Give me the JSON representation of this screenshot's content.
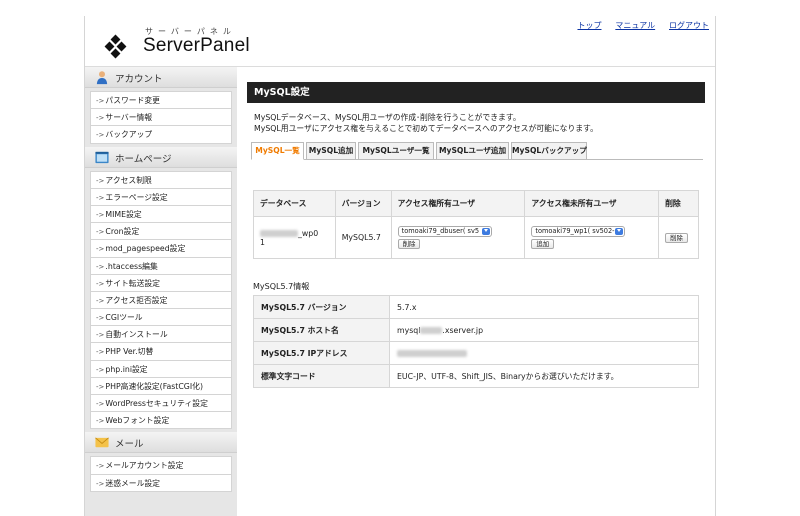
{
  "header": {
    "logo_kana": "サーバーパネル",
    "logo_text": "ServerPanel",
    "links": [
      "トップ",
      "マニュアル",
      "ログアウト"
    ]
  },
  "sidebar": {
    "sections": [
      {
        "title": "アカウント",
        "icon": "user-icon",
        "items": [
          "パスワード変更",
          "サーバー情報",
          "バックアップ"
        ]
      },
      {
        "title": "ホームページ",
        "icon": "homepage-icon",
        "items": [
          "アクセス制限",
          "エラーページ設定",
          "MIME設定",
          "Cron設定",
          "mod_pagespeed設定",
          ".htaccess編集",
          "サイト転送設定",
          "アクセス拒否設定",
          "CGIツール",
          "自動インストール",
          "PHP Ver.切替",
          "php.ini設定",
          "PHP高速化設定(FastCGI化)",
          "WordPressセキュリティ設定",
          "Webフォント設定"
        ]
      },
      {
        "title": "メール",
        "icon": "mail-icon",
        "items": [
          "メールアカウント設定",
          "迷惑メール設定"
        ]
      }
    ]
  },
  "main": {
    "title": "MySQL設定",
    "desc1": "MySQLデータベース、MySQL用ユーザの作成･削除を行うことができます。",
    "desc2": "MySQL用ユーザにアクセス権を与えることで初めてデータベースへのアクセスが可能になります。",
    "tabs": [
      "MySQL一覧",
      "MySQL追加",
      "MySQLユーザ一覧",
      "MySQLユーザ追加",
      "MySQLバックアップ"
    ],
    "active_tab": 0,
    "db_table": {
      "headers": [
        "データベース",
        "バージョン",
        "アクセス権所有ユーザ",
        "アクセス権未所有ユーザ",
        "削除"
      ],
      "row": {
        "db_suffix": "_wp0",
        "db_suffix2": "1",
        "version": "MySQL5.7",
        "owner_select": "tomoaki79_dbuser( sv5",
        "owner_button": "削除",
        "nonowner_select": "tomoaki79_wp1( sv502-",
        "nonowner_button": "追加",
        "delete_button": "削除"
      }
    },
    "info_title": "MySQL5.7情報",
    "info_rows": [
      {
        "label": "MySQL5.7 バージョン",
        "value": "5.7.x"
      },
      {
        "label": "MySQL5.7 ホスト名",
        "value_prefix": "mysql",
        "value_suffix": ".xserver.jp"
      },
      {
        "label": "MySQL5.7 IPアドレス",
        "value": ""
      },
      {
        "label": "標準文字コード",
        "value": "EUC-JP、UTF-8、Shift_JIS、Binaryからお選びいただけます。"
      }
    ]
  }
}
